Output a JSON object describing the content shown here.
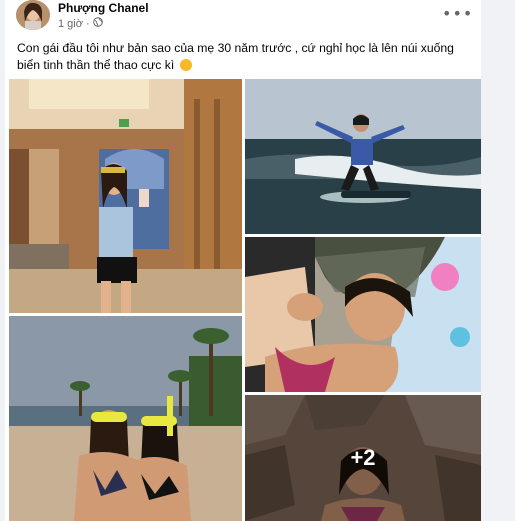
{
  "post": {
    "author": "Phượng Chanel",
    "time": "1 giờ",
    "privacy_icon": "globe-icon",
    "menu_icon": "more-options-icon",
    "more_label": "•••",
    "caption_text": "Con gái đầu tôi như bản sao của mẹ 30 năm trước , cứ nghỉ học là lên núi xuống biển tinh thần thể thao cực kì",
    "caption_emoji": "smiling-cat-emoji",
    "photos": [
      {
        "description_icon": "photo-mirror-selfie"
      },
      {
        "description_icon": "photo-surfing"
      },
      {
        "description_icon": "photo-lying-selfie"
      },
      {
        "description_icon": "photo-beach-snorkel"
      },
      {
        "description_icon": "photo-rock-selfie"
      }
    ],
    "more_photos_count": "+2"
  },
  "colors": {
    "page_bg": "#f0f2f5",
    "card_bg": "#ffffff",
    "text_primary": "#050505",
    "text_secondary": "#65676b"
  }
}
